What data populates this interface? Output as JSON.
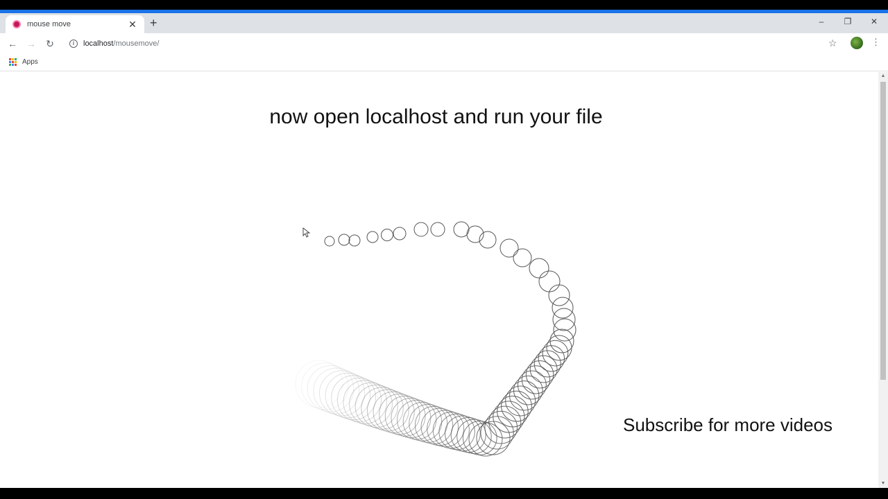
{
  "browser": {
    "tab": {
      "title": "mouse move",
      "close_label": "✕"
    },
    "new_tab_label": "+",
    "window_controls": {
      "minimize": "–",
      "restore": "❐",
      "close": "✕"
    },
    "nav": {
      "back": "←",
      "forward": "→",
      "reload": "↻"
    },
    "address": {
      "host": "localhost",
      "path": "/mousemove/"
    },
    "star": "☆",
    "menu": "⋮",
    "bookmarks": {
      "apps_label": "Apps"
    }
  },
  "page": {
    "heading": "now open localhost and run your file",
    "subscribe_text": "Subscribe for more videos"
  },
  "colors": {
    "accent": "#1a73e8",
    "favicon": "#c2185b",
    "circle_stroke": "#555555"
  }
}
